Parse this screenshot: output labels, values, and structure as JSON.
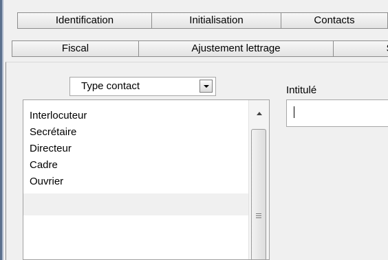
{
  "tabs": {
    "row1": [
      "Identification",
      "Initialisation",
      "Contacts",
      ""
    ],
    "row2": [
      "Fiscal",
      "Ajustement lettrage",
      "Sy"
    ]
  },
  "contact_type": {
    "selected": "Type contact"
  },
  "contacts_list": [
    "Interlocuteur",
    "Secrétaire",
    "Directeur",
    "Cadre",
    "Ouvrier"
  ],
  "title_field": {
    "label": "Intitulé",
    "value": ""
  }
}
